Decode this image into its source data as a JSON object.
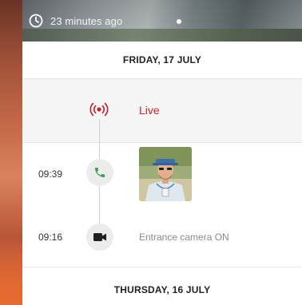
{
  "banner": {
    "elapsed": "23 minutes ago",
    "clock_icon": "clock-icon"
  },
  "timeline": {
    "days": [
      {
        "date": "FRIDAY, 17 JULY",
        "live": {
          "label": "Live",
          "icon": "live-broadcast-icon",
          "color": "#c1272d"
        },
        "events": [
          {
            "time": "09:39",
            "icon": "phone-call-icon",
            "icon_color": "#3aa055",
            "thumbnail": "visitor-snapshot"
          },
          {
            "time": "09:16",
            "icon": "video-camera-icon",
            "text": "Entrance camera ON"
          }
        ]
      },
      {
        "date": "THURSDAY, 16 JULY"
      }
    ]
  }
}
